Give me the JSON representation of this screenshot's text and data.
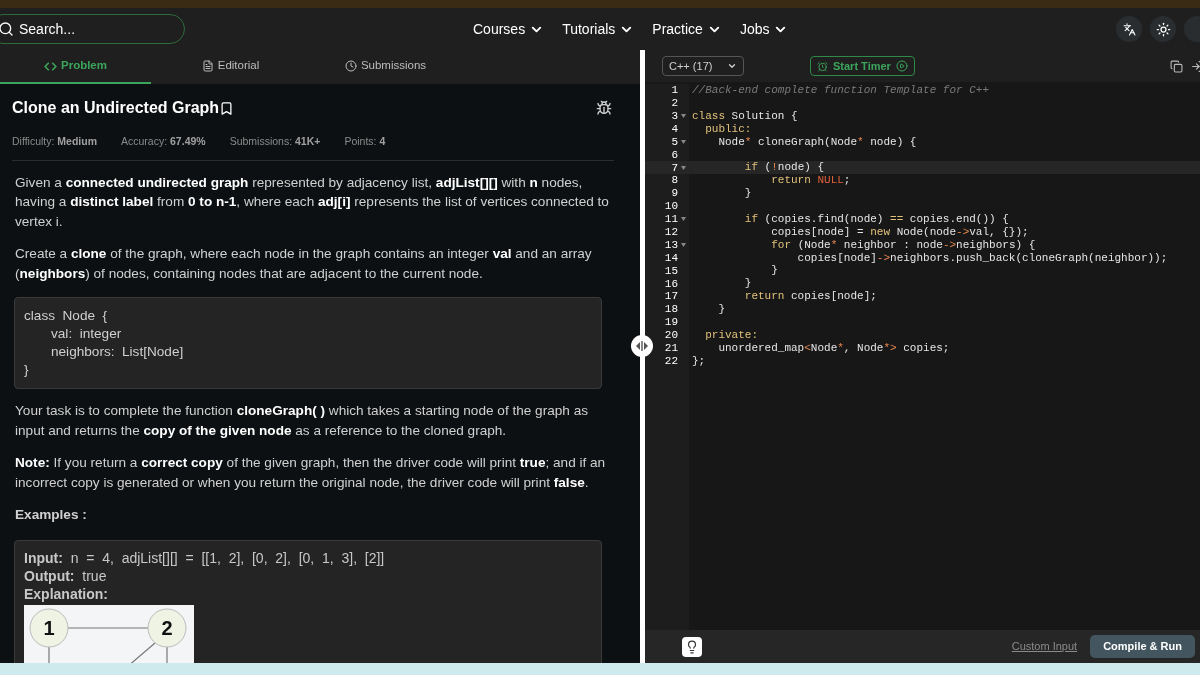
{
  "nav": {
    "search": {
      "placeholder": "Search..."
    },
    "menus": [
      {
        "label": "Courses"
      },
      {
        "label": "Tutorials"
      },
      {
        "label": "Practice"
      },
      {
        "label": "Jobs"
      }
    ]
  },
  "tabs": [
    {
      "label": "Problem",
      "kind": "code",
      "selected": true
    },
    {
      "label": "Editorial",
      "kind": "document",
      "selected": false
    },
    {
      "label": "Submissions",
      "kind": "clock",
      "selected": false
    }
  ],
  "problem": {
    "title": "Clone an Undirected Graph",
    "bookmarked": false,
    "meta": [
      {
        "label": "Difficulty:",
        "value": "Medium"
      },
      {
        "label": "Accuracy:",
        "value": "67.49%"
      },
      {
        "label": "Submissions:",
        "value": "41K+"
      },
      {
        "label": "Points:",
        "value": "4"
      }
    ],
    "paragraphs_before": [
      "Given a **connected undirected graph** represented by adjacency list, **adjList[][]** with **n** nodes, having a **distinct label** from **0 to n-1**, where each **adj[i]** represents the list of vertices connected to vertex i.",
      "Create a **clone** of the graph, where each node in the graph contains an integer **val** and an array (**neighbors**) of nodes, containing nodes that are adjacent to the current node."
    ],
    "code_block": [
      {
        "text": "class  Node  {",
        "indented": false
      },
      {
        "text": "val:  integer",
        "indented": true
      },
      {
        "text": "neighbors:  List[Node]",
        "indented": true
      },
      {
        "text": "}",
        "indented": false
      }
    ],
    "paragraphs_after": [
      "Your task is to complete the function **cloneGraph( )** which takes a starting node of the graph as input and returns the **copy of the given node** as a reference to the cloned graph.",
      "**Note:** If you return a **correct copy** of the given graph, then the driver code will print **true**; and if an incorrect copy is generated or when you return the original node, the driver code will print **false**."
    ],
    "examples_heading": "Examples :",
    "example": [
      {
        "label": "Input:",
        "value": "n  =  4,  adjList[][]  =  [[1,  2],  [0,  2],  [0,  1,  3],  [2]]"
      },
      {
        "label": "Output:",
        "value": "true"
      },
      {
        "label": "Explanation:"
      }
    ],
    "graph_nodes": [
      "1",
      "2"
    ]
  },
  "editor": {
    "language": "C++ (17)",
    "timer": "Start Timer",
    "lines": [
      {
        "number": "1",
        "fold": false,
        "current": false,
        "tokens": [
          {
            "text": "//Back-end complete function Template for C++",
            "kind": "comment"
          }
        ]
      },
      {
        "number": "2",
        "fold": false,
        "current": false
      },
      {
        "number": "3",
        "fold": true,
        "current": false,
        "tokens": [
          {
            "text": "class",
            "kind": "keyword"
          },
          {
            "text": " Solution {",
            "kind": "plain"
          }
        ]
      },
      {
        "number": "4",
        "fold": false,
        "current": false,
        "tokens": [
          {
            "text": "  public:",
            "kind": "keyword"
          }
        ]
      },
      {
        "number": "5",
        "fold": true,
        "current": false,
        "tokens": [
          {
            "text": "    Node",
            "kind": "plain"
          },
          {
            "text": "*",
            "kind": "operator"
          },
          {
            "text": " cloneGraph(Node",
            "kind": "plain"
          },
          {
            "text": "*",
            "kind": "operator"
          },
          {
            "text": " node) {",
            "kind": "plain"
          }
        ]
      },
      {
        "number": "6",
        "fold": false,
        "current": false
      },
      {
        "number": "7",
        "fold": true,
        "current": true,
        "tokens": [
          {
            "text": "        if",
            "kind": "keyword"
          },
          {
            "text": " (",
            "kind": "plain"
          },
          {
            "text": "!",
            "kind": "operator"
          },
          {
            "text": "node) {",
            "kind": "plain"
          }
        ]
      },
      {
        "number": "8",
        "fold": false,
        "current": false,
        "tokens": [
          {
            "text": "            return",
            "kind": "keyword"
          },
          {
            "text": " NULL",
            "kind": "constant"
          },
          {
            "text": ";",
            "kind": "plain"
          }
        ]
      },
      {
        "number": "9",
        "fold": false,
        "current": false,
        "tokens": [
          {
            "text": "        }",
            "kind": "plain"
          }
        ]
      },
      {
        "number": "10",
        "fold": false,
        "current": false
      },
      {
        "number": "11",
        "fold": true,
        "current": false,
        "tokens": [
          {
            "text": "        if",
            "kind": "keyword"
          },
          {
            "text": " (copies.find(node) ",
            "kind": "plain"
          },
          {
            "text": "==",
            "kind": "keyword"
          },
          {
            "text": " copies.end()) {",
            "kind": "plain"
          }
        ]
      },
      {
        "number": "12",
        "fold": false,
        "current": false,
        "tokens": [
          {
            "text": "            copies[node] = ",
            "kind": "plain"
          },
          {
            "text": "new",
            "kind": "keyword"
          },
          {
            "text": " Node(node",
            "kind": "plain"
          },
          {
            "text": "->",
            "kind": "operator"
          },
          {
            "text": "val, {});",
            "kind": "plain"
          }
        ]
      },
      {
        "number": "13",
        "fold": true,
        "current": false,
        "tokens": [
          {
            "text": "            for",
            "kind": "keyword"
          },
          {
            "text": " (Node",
            "kind": "plain"
          },
          {
            "text": "*",
            "kind": "operator"
          },
          {
            "text": " neighbor : node",
            "kind": "plain"
          },
          {
            "text": "->",
            "kind": "operator"
          },
          {
            "text": "neighbors) {",
            "kind": "plain"
          }
        ]
      },
      {
        "number": "14",
        "fold": false,
        "current": false,
        "tokens": [
          {
            "text": "                copies[node]",
            "kind": "plain"
          },
          {
            "text": "->",
            "kind": "operator"
          },
          {
            "text": "neighbors.push_back(cloneGraph(neighbor));",
            "kind": "plain"
          }
        ]
      },
      {
        "number": "15",
        "fold": false,
        "current": false,
        "tokens": [
          {
            "text": "            }",
            "kind": "plain"
          }
        ]
      },
      {
        "number": "16",
        "fold": false,
        "current": false,
        "tokens": [
          {
            "text": "        }",
            "kind": "plain"
          }
        ]
      },
      {
        "number": "17",
        "fold": false,
        "current": false,
        "tokens": [
          {
            "text": "        return",
            "kind": "keyword"
          },
          {
            "text": " copies[node];",
            "kind": "plain"
          }
        ]
      },
      {
        "number": "18",
        "fold": false,
        "current": false,
        "tokens": [
          {
            "text": "    }",
            "kind": "plain"
          }
        ]
      },
      {
        "number": "19",
        "fold": false,
        "current": false
      },
      {
        "number": "20",
        "fold": false,
        "current": false,
        "tokens": [
          {
            "text": "  private:",
            "kind": "keyword"
          }
        ]
      },
      {
        "number": "21",
        "fold": false,
        "current": false,
        "tokens": [
          {
            "text": "    unordered_map",
            "kind": "plain"
          },
          {
            "text": "<",
            "kind": "operator"
          },
          {
            "text": "Node",
            "kind": "plain"
          },
          {
            "text": "*",
            "kind": "operator"
          },
          {
            "text": ", Node",
            "kind": "plain"
          },
          {
            "text": "*>",
            "kind": "operator"
          },
          {
            "text": " copies;",
            "kind": "plain"
          }
        ]
      },
      {
        "number": "22",
        "fold": false,
        "current": false,
        "tokens": [
          {
            "text": "};",
            "kind": "plain"
          }
        ]
      }
    ],
    "custom_input": "Custom Input",
    "run": "Compile & Run"
  }
}
